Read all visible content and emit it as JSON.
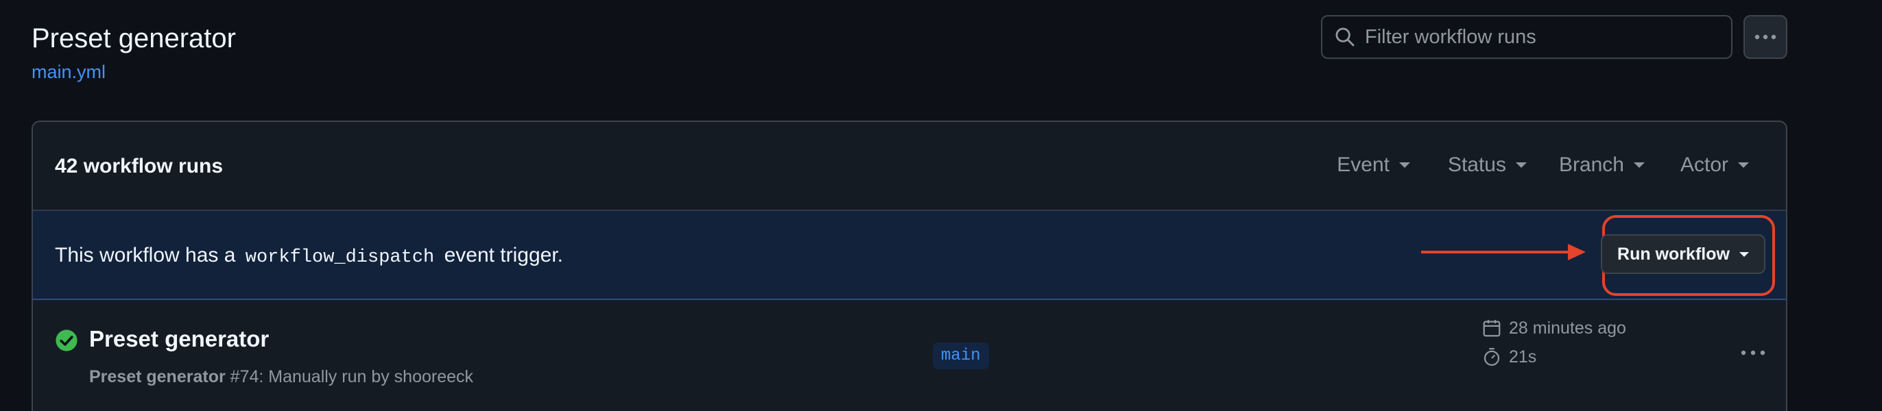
{
  "header": {
    "title": "Preset generator",
    "subtitle": "main.yml",
    "search": {
      "placeholder": "Filter workflow runs",
      "value": "",
      "icon": "search-icon"
    },
    "more_icon": "kebab-horizontal-icon"
  },
  "runs_panel": {
    "count_label": "42 workflow runs",
    "filters": [
      "Event",
      "Status",
      "Branch",
      "Actor"
    ],
    "dispatch": {
      "text_before": "This workflow has a",
      "code": "workflow_dispatch",
      "text_after": "event trigger.",
      "run_button_label": "Run workflow"
    },
    "runs": [
      {
        "status": "success",
        "title": "Preset generator",
        "meta_workflow": "Preset generator",
        "meta_detail": "#74: Manually run by shooreeck",
        "branch": "main",
        "time_ago": "28 minutes ago",
        "duration": "21s"
      }
    ]
  },
  "colors": {
    "background": "#0d1117",
    "panel": "#151b23",
    "accent_link": "#4493f8",
    "success": "#3fb950",
    "annotation": "#e5432a",
    "dispatch_band": "#12223b"
  }
}
